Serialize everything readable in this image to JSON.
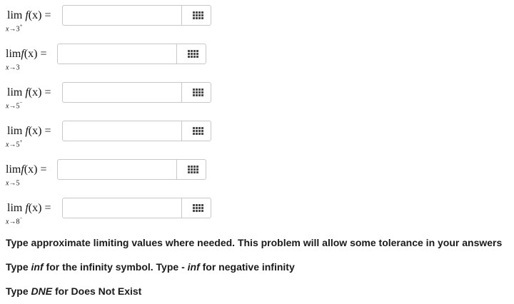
{
  "limits": [
    {
      "lim": "lim",
      "fx": "f",
      "arg": "(x) =",
      "var": "x",
      "arrow": "→",
      "value": "3",
      "side": "+"
    },
    {
      "lim": "lim",
      "fx": "f",
      "arg": "(x) =",
      "var": "x",
      "arrow": "→",
      "value": "3",
      "side": ""
    },
    {
      "lim": "lim",
      "fx": "f",
      "arg": "(x) =",
      "var": "x",
      "arrow": "→",
      "value": "5",
      "side": "−"
    },
    {
      "lim": "lim",
      "fx": "f",
      "arg": "(x) =",
      "var": "x",
      "arrow": "→",
      "value": "5",
      "side": "+"
    },
    {
      "lim": "lim",
      "fx": "f",
      "arg": "(x) =",
      "var": "x",
      "arrow": "→",
      "value": "5",
      "side": ""
    },
    {
      "lim": "lim",
      "fx": "f",
      "arg": "(x) =",
      "var": "x",
      "arrow": "→",
      "value": "8",
      "side": "−"
    }
  ],
  "answers": [
    "",
    "",
    "",
    "",
    "",
    ""
  ],
  "palette_icon": "grid-palette-icon",
  "notes": {
    "line1": "Type approximate limiting values where needed. This problem will allow some tolerance in your answers",
    "line2_a": "Type ",
    "line2_b": "inf",
    "line2_c": " for the infinity symbol. Type - ",
    "line2_d": "inf",
    "line2_e": " for negative infinity",
    "line3_a": "Type ",
    "line3_b": "DNE",
    "line3_c": " for Does Not Exist"
  }
}
